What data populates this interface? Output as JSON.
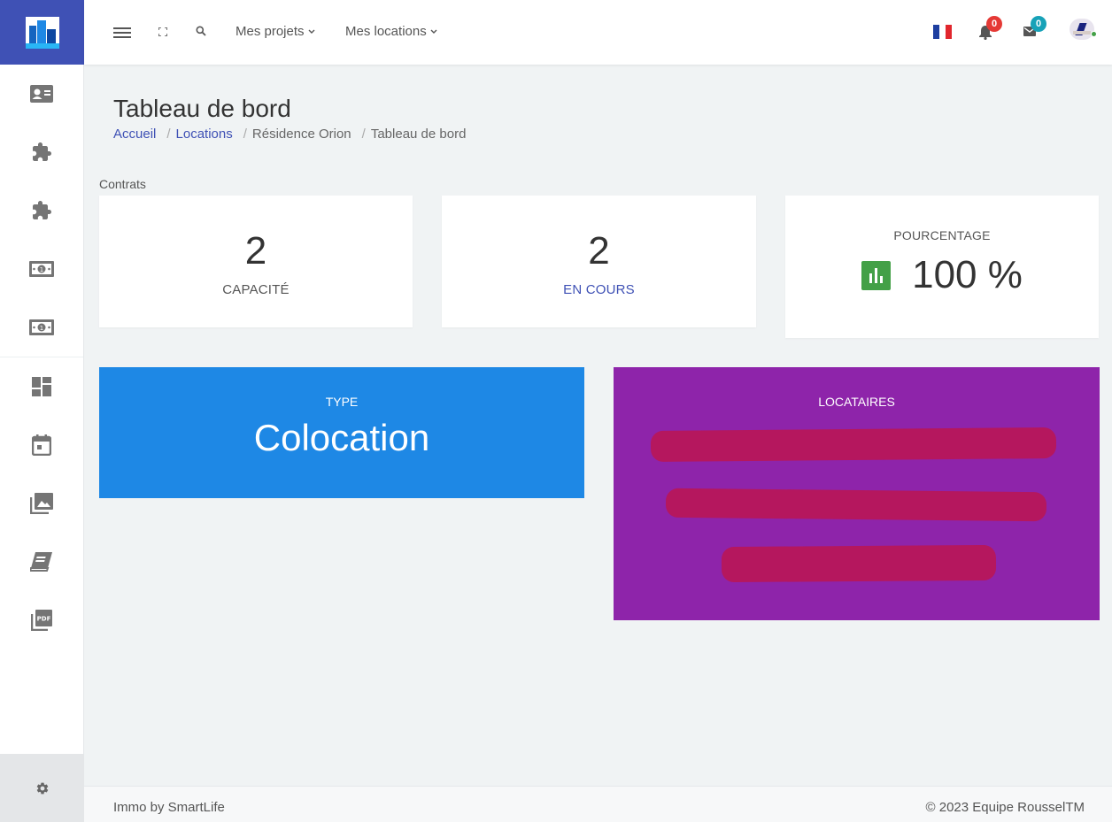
{
  "topbar": {
    "nav": [
      {
        "label": "Mes projets"
      },
      {
        "label": "Mes locations"
      }
    ],
    "notifications_count": "0",
    "messages_count": "0"
  },
  "page": {
    "title": "Tableau de bord",
    "breadcrumb": [
      "Accueil",
      "Locations",
      "Résidence Orion",
      "Tableau de bord"
    ]
  },
  "contrats": {
    "section_label": "Contrats",
    "capacite": {
      "value": "2",
      "label": "CAPACITÉ"
    },
    "en_cours": {
      "value": "2",
      "label": "EN COURS"
    },
    "pourcentage": {
      "label": "POURCENTAGE",
      "value": "100 %"
    }
  },
  "type_card": {
    "label": "TYPE",
    "value": "Colocation"
  },
  "locataires_card": {
    "label": "LOCATAIRES"
  },
  "footer": {
    "left": "Immo by SmartLife",
    "right": "© 2023 Equipe RousselTM"
  },
  "colors": {
    "brand": "#3f51b5",
    "type_card": "#1e88e5",
    "locataires_card": "#8e24aa",
    "percentage_icon": "#43a047",
    "badge_red": "#e53935",
    "badge_cyan": "#17a2b8"
  },
  "icons": {
    "sidebar": [
      "contact-card-icon",
      "puzzle-icon",
      "puzzle-icon",
      "money-icon",
      "money-icon",
      "dashboard-icon",
      "calendar-icon",
      "photo-library-icon",
      "book-icon",
      "pdf-icon"
    ],
    "sidebar_bottom": "gear-icon",
    "topbar": [
      "menu-icon",
      "fullscreen-icon",
      "search-icon",
      "france-flag-icon",
      "bell-icon",
      "mail-icon",
      "avatar"
    ]
  }
}
